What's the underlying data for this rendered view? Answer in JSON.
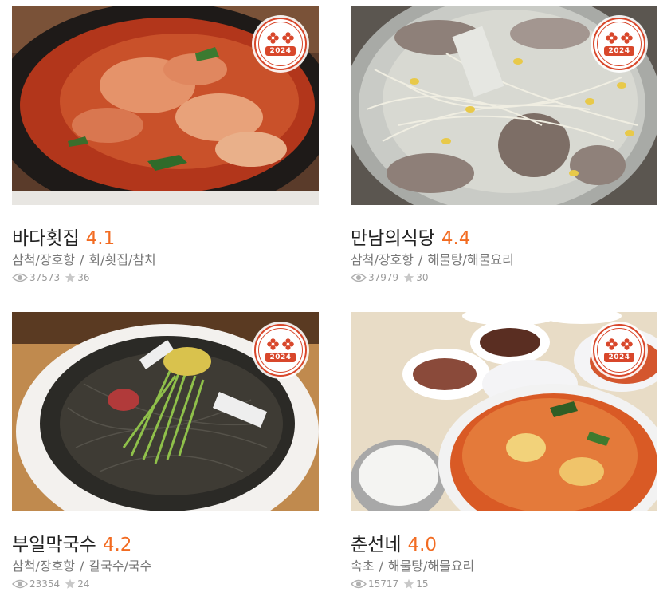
{
  "badge": {
    "year": "2024"
  },
  "colors": {
    "rating": "#f26b21",
    "badge": "#d8472b",
    "name": "#222222",
    "meta": "#777777"
  },
  "restaurants": [
    {
      "name": "바다횟집",
      "rating": "4.1",
      "region": "삼척/장호항",
      "separator": "/",
      "category": "회/횟집/참치",
      "views": "37573",
      "favorites": "36",
      "image": "spicy-fish-stew-hotpot"
    },
    {
      "name": "만남의식당",
      "rating": "4.4",
      "region": "삼척/장호항",
      "separator": "/",
      "category": "해물탕/해물요리",
      "views": "37979",
      "favorites": "30",
      "image": "clear-soup-with-bean-sprouts"
    },
    {
      "name": "부일막국수",
      "rating": "4.2",
      "region": "삼척/장호항",
      "separator": "/",
      "category": "칼국수/국수",
      "views": "23354",
      "favorites": "24",
      "image": "cold-buckwheat-noodles"
    },
    {
      "name": "춘선네",
      "rating": "4.0",
      "region": "속초",
      "separator": "/",
      "category": "해물탕/해물요리",
      "views": "15717",
      "favorites": "15",
      "image": "red-stew-with-side-dishes"
    }
  ]
}
